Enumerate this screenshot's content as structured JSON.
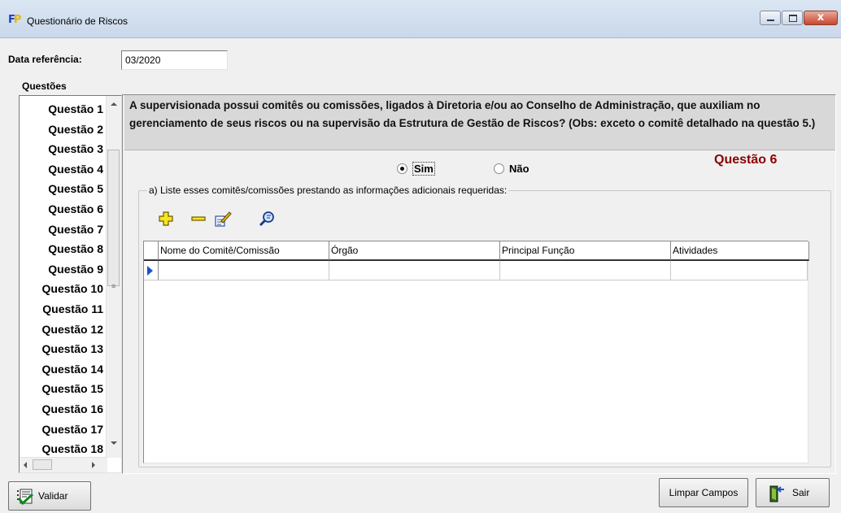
{
  "window": {
    "title": "Questionário de Riscos"
  },
  "date_ref": {
    "label": "Data referência:",
    "value": "03/2020"
  },
  "questions_header": "Questões",
  "questions": [
    "Questão 1",
    "Questão 2",
    "Questão 3",
    "Questão 4",
    "Questão 5",
    "Questão 6",
    "Questão 7",
    "Questão 8",
    "Questão 9",
    "Questão 10",
    "Questão 11",
    "Questão 12",
    "Questão 13",
    "Questão 14",
    "Questão 15",
    "Questão 16",
    "Questão 17",
    "Questão 18"
  ],
  "question": {
    "text": "A supervisionada possui comitês ou comissões, ligados à Diretoria e/ou ao Conselho de Administração, que auxiliam no gerenciamento de seus riscos ou na supervisão da Estrutura de Gestão de Riscos? (Obs: exceto o comitê detalhado na questão 5.)",
    "number_label": "Questão 6",
    "options": {
      "yes": "Sim",
      "no": "Não",
      "selected": "Sim"
    }
  },
  "group": {
    "legend": "a) Liste esses comitês/comissões prestando as informações adicionais requeridas:"
  },
  "toolbar": {
    "icons": [
      "add-icon",
      "remove-icon",
      "edit-icon",
      "search-icon"
    ]
  },
  "grid": {
    "columns": [
      "Nome do Comitê/Comissão",
      "Órgão",
      "Principal Função",
      "Atividades"
    ],
    "rows": [
      [
        "",
        "",
        "",
        ""
      ]
    ]
  },
  "buttons": {
    "validate": "Validar",
    "clear": "Limpar Campos",
    "exit": "Sair"
  },
  "colors": {
    "question_number": "#8b0000",
    "row_indicator": "#1a4fd1",
    "question_bg": "#d8d8d8"
  }
}
